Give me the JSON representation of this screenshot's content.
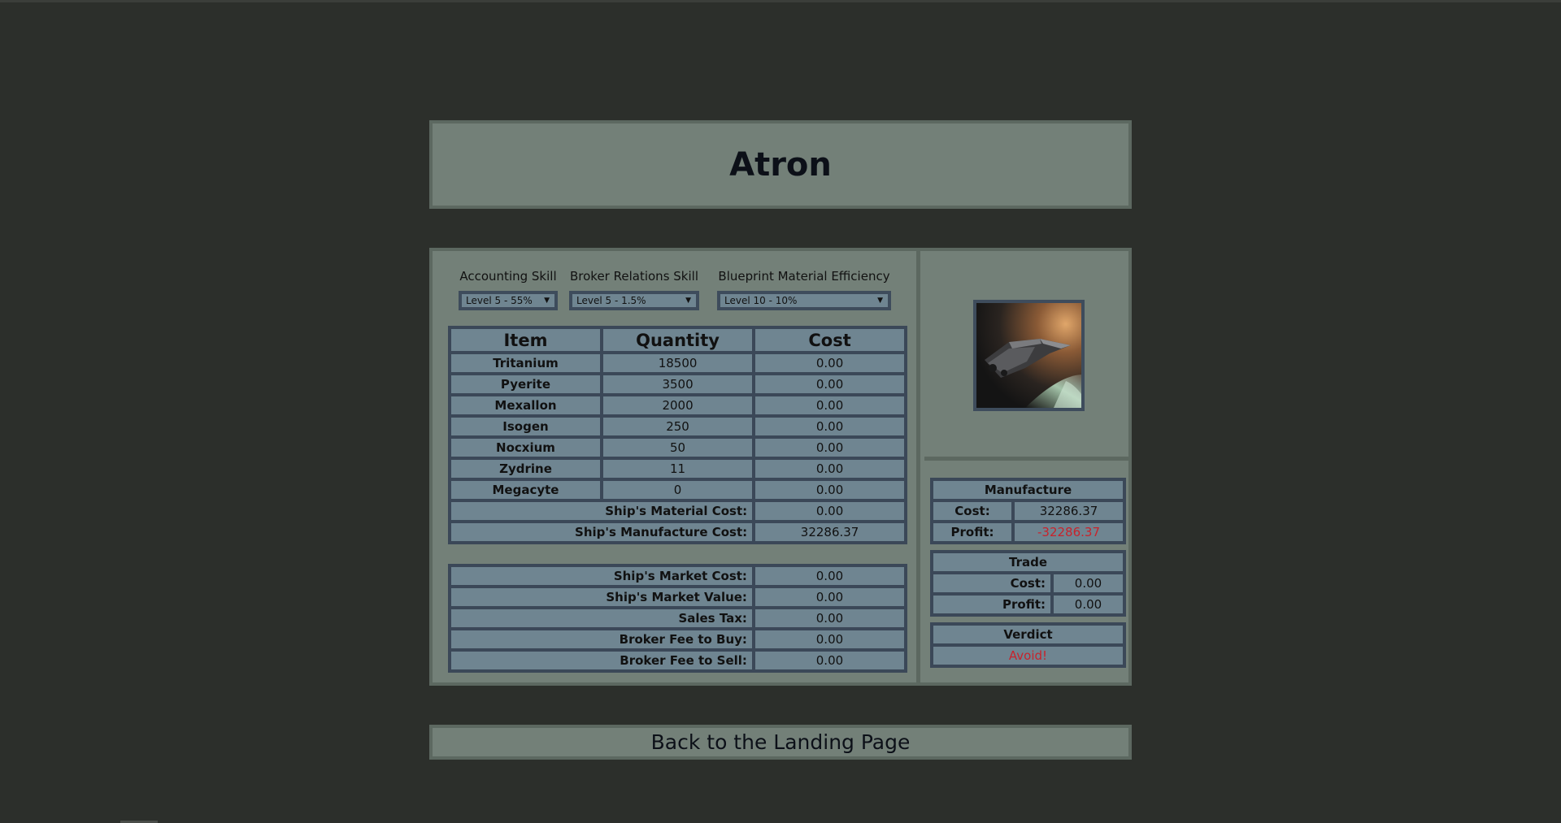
{
  "page": {
    "title": "Atron"
  },
  "skills": [
    {
      "label": "Accounting Skill",
      "value": "Level 5 - 55%"
    },
    {
      "label": "Broker Relations Skill",
      "value": "Level 5 - 1.5%"
    },
    {
      "label": "Blueprint Material Efficiency",
      "value": "Level 10 - 10%"
    }
  ],
  "materials": {
    "headers": [
      "Item",
      "Quantity",
      "Cost"
    ],
    "rows": [
      {
        "item": "Tritanium",
        "quantity": "18500",
        "cost": "0.00"
      },
      {
        "item": "Pyerite",
        "quantity": "3500",
        "cost": "0.00"
      },
      {
        "item": "Mexallon",
        "quantity": "2000",
        "cost": "0.00"
      },
      {
        "item": "Isogen",
        "quantity": "250",
        "cost": "0.00"
      },
      {
        "item": "Nocxium",
        "quantity": "50",
        "cost": "0.00"
      },
      {
        "item": "Zydrine",
        "quantity": "11",
        "cost": "0.00"
      },
      {
        "item": "Megacyte",
        "quantity": "0",
        "cost": "0.00"
      }
    ],
    "material_cost_label": "Ship's Material Cost:",
    "material_cost": "0.00",
    "manufacture_cost_label": "Ship's Manufacture Cost:",
    "manufacture_cost": "32286.37"
  },
  "market": [
    {
      "label": "Ship's Market Cost:",
      "value": "0.00"
    },
    {
      "label": "Ship's Market Value:",
      "value": "0.00"
    },
    {
      "label": "Sales Tax:",
      "value": "0.00"
    },
    {
      "label": "Broker Fee to Buy:",
      "value": "0.00"
    },
    {
      "label": "Broker Fee to Sell:",
      "value": "0.00"
    }
  ],
  "manufacture": {
    "heading": "Manufacture",
    "cost_label": "Cost:",
    "cost": "32286.37",
    "profit_label": "Profit:",
    "profit": "-32286.37"
  },
  "trade": {
    "heading": "Trade",
    "cost_label": "Cost:",
    "cost": "0.00",
    "profit_label": "Profit:",
    "profit": "0.00"
  },
  "verdict": {
    "heading": "Verdict",
    "value": "Avoid!"
  },
  "colors": {
    "negative": "#c8232c",
    "panel": "#738078",
    "cell": "#6f8591",
    "border": "#3b4858"
  },
  "back_link": "Back to the Landing Page"
}
